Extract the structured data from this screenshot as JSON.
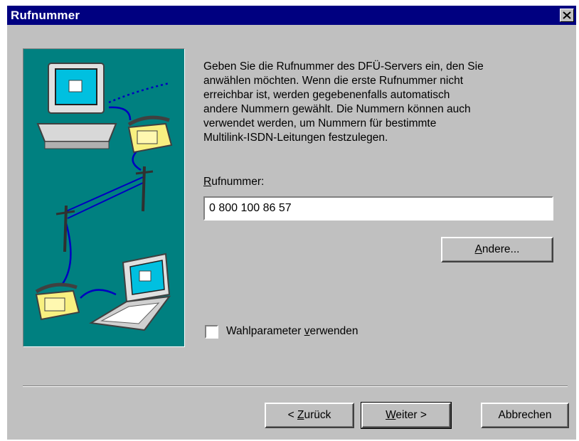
{
  "window": {
    "title": "Rufnummer"
  },
  "description": [
    "Geben Sie die Rufnummer des DFÜ-Servers ein, den Sie",
    "anwählen möchten. Wenn die erste Rufnummer nicht",
    "erreichbar ist, werden gegebenenfalls automatisch",
    "andere Nummern gewählt. Die Nummern können auch",
    "verwendet werden, um Nummern für bestimmte",
    "Multilink-ISDN-Leitungen festzulegen."
  ],
  "phone_field": {
    "label_mnemonic": "R",
    "label_rest": "ufnummer:",
    "value": "0 800 100 86 57"
  },
  "buttons": {
    "other_mnemonic": "A",
    "other_rest": "ndere...",
    "back_prefix": "< ",
    "back_mnemonic": "Z",
    "back_rest": "urück",
    "next_mnemonic": "W",
    "next_rest": "eiter >",
    "cancel": "Abbrechen"
  },
  "dialing_rules": {
    "label_before": "Wahlparameter ",
    "label_mnemonic": "v",
    "label_after": "erwenden",
    "checked": false
  },
  "colors": {
    "titlebar": "#000080",
    "face": "#c0c0c0",
    "illustration_bg": "#008080"
  }
}
